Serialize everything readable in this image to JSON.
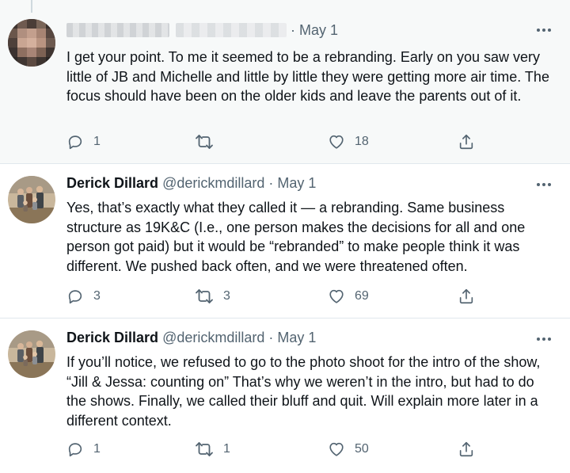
{
  "tweets": [
    {
      "name": "",
      "handle": "",
      "date": "May 1",
      "text": "I get your point. To me it seemed to be a rebranding. Early on you saw very little of JB and Michelle and little by little they were getting more air time. The focus should have been on the older kids and leave the parents out of it.",
      "replies": "1",
      "retweets": "",
      "likes": "18"
    },
    {
      "name": "Derick Dillard",
      "handle": "@derickmdillard",
      "date": "May 1",
      "text": "Yes, that’s exactly what they called it — a rebranding.  Same business structure as 19K&C (I.e., one person makes the decisions for all and one person got paid) but it would be “rebranded” to make people think it was different. We pushed back often, and we were threatened often.",
      "replies": "3",
      "retweets": "3",
      "likes": "69"
    },
    {
      "name": "Derick Dillard",
      "handle": "@derickmdillard",
      "date": "May 1",
      "text": "If you’ll notice, we refused to go to the photo shoot for the intro of the show, “Jill & Jessa:  counting on” That’s why we weren’t in the intro, but had to do the shows. Finally, we called their bluff and quit.  Will explain more later in a different context.",
      "replies": "1",
      "retweets": "1",
      "likes": "50"
    }
  ],
  "separator": "·",
  "icons": {
    "reply": "reply-icon",
    "retweet": "retweet-icon",
    "like": "heart-icon",
    "share": "share-icon",
    "more": "more-icon"
  },
  "colors": {
    "highlight_bg": "#f7f9f9",
    "secondary_text": "#536471",
    "border": "#e1e8ed"
  }
}
